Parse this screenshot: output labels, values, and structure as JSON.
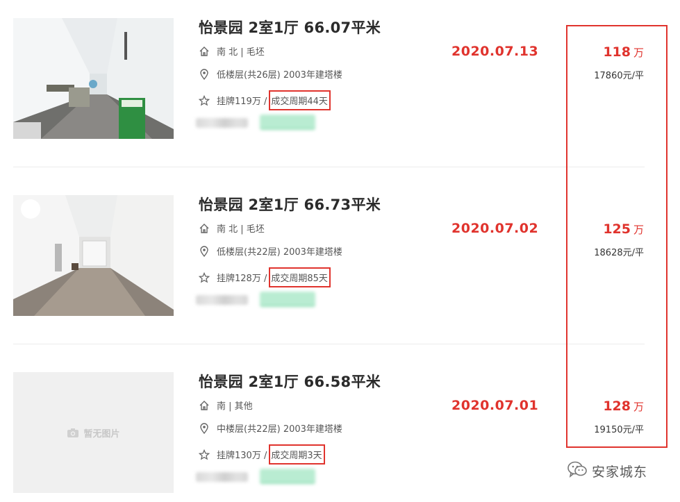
{
  "listings": [
    {
      "title": "怡景园 2室1厅 66.07平米",
      "house_info": "南 北 | 毛坯",
      "position_info": "低楼层(共26层) 2003年建塔楼",
      "list_price": "挂牌119万 /",
      "deal_cycle": "成交周期44天",
      "deal_date": "2020.07.13",
      "total_price": "118",
      "price_unit": "万",
      "unit_price": "17860元/平",
      "has_photo": true
    },
    {
      "title": "怡景园 2室1厅 66.73平米",
      "house_info": "南 北 | 毛坯",
      "position_info": "低楼层(共22层) 2003年建塔楼",
      "list_price": "挂牌128万 /",
      "deal_cycle": "成交周期85天",
      "deal_date": "2020.07.02",
      "total_price": "125",
      "price_unit": "万",
      "unit_price": "18628元/平",
      "has_photo": true
    },
    {
      "title": "怡景园 2室1厅 66.58平米",
      "house_info": "南 | 其他",
      "position_info": "中楼层(共22层) 2003年建塔楼",
      "list_price": "挂牌130万 /",
      "deal_cycle": "成交周期3天",
      "deal_date": "2020.07.01",
      "total_price": "128",
      "price_unit": "万",
      "unit_price": "19150元/平",
      "has_photo": false,
      "no_photo_text": "暂无图片"
    }
  ],
  "watermark": {
    "text": "安家城东",
    "icon": "wechat-icon"
  },
  "icons": {
    "house": "house-icon",
    "position": "location-pin-icon",
    "deal": "star-icon",
    "no_photo": "camera-icon"
  },
  "colors": {
    "accent_red": "#e0332d",
    "title": "#2b2b2b",
    "blurred_tag": "#b9ecd2"
  }
}
